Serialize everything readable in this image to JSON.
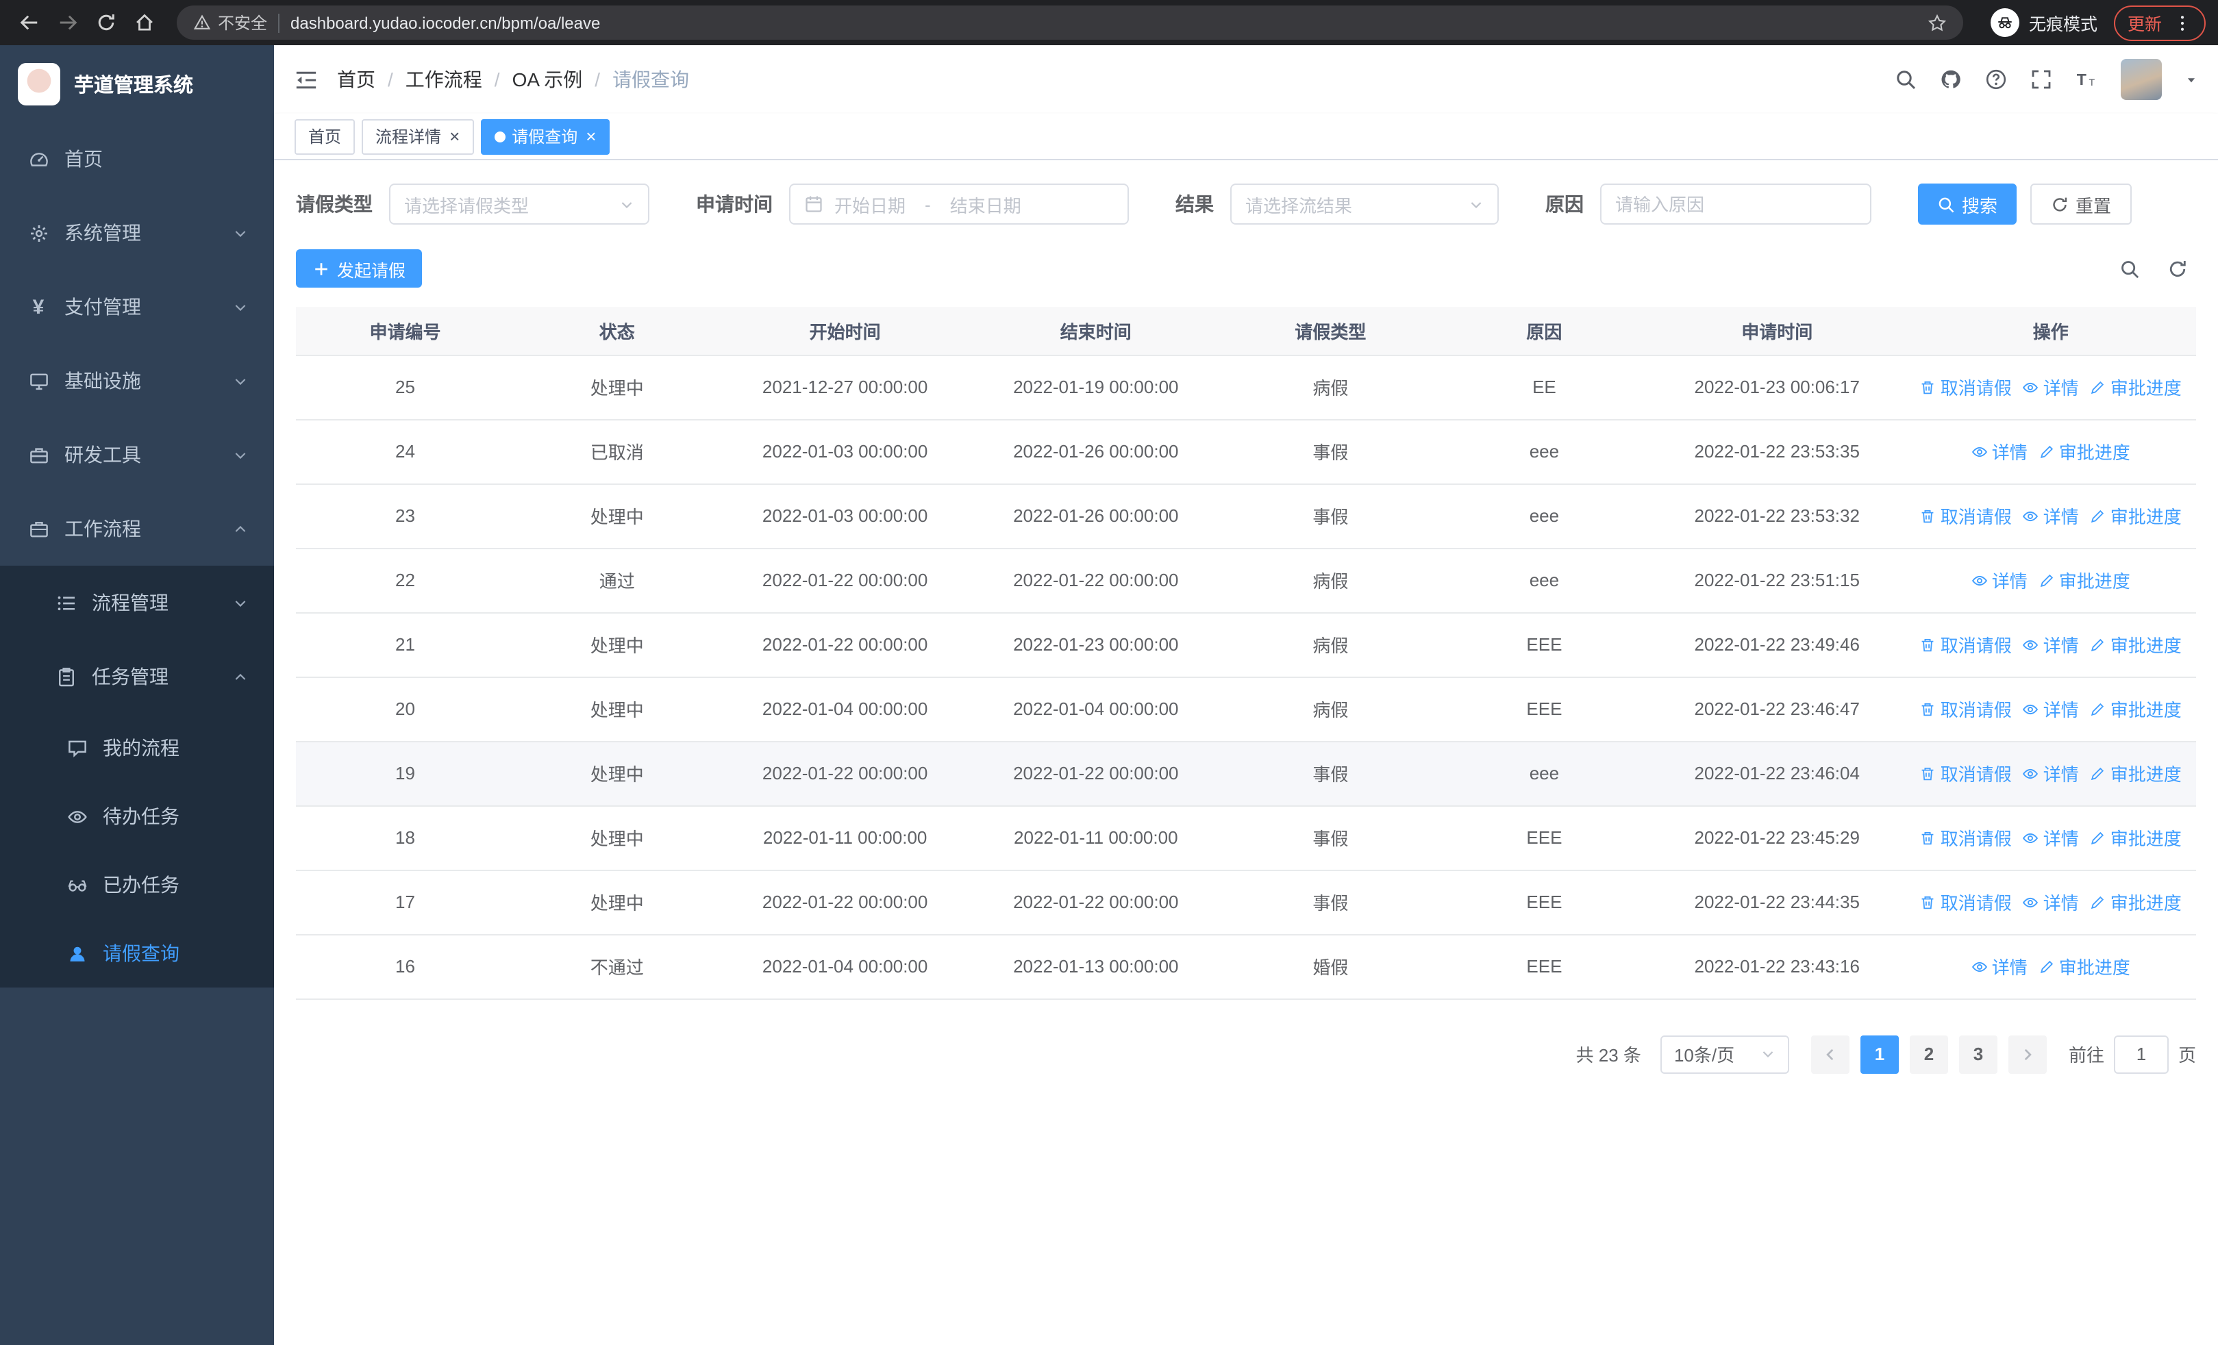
{
  "browser": {
    "security_warning": "不安全",
    "url": "dashboard.yudao.iocoder.cn/bpm/oa/leave",
    "incognito_label": "无痕模式",
    "update_label": "更新"
  },
  "sidebar": {
    "app_title": "芋道管理系统",
    "items": [
      {
        "name": "home",
        "label": "首页",
        "icon": "dashboard",
        "level": 1
      },
      {
        "name": "system-management",
        "label": "系统管理",
        "icon": "gear",
        "level": 1,
        "chevron": "down"
      },
      {
        "name": "payment-management",
        "label": "支付管理",
        "icon": "yen",
        "level": 1,
        "chevron": "down"
      },
      {
        "name": "infrastructure",
        "label": "基础设施",
        "icon": "monitor",
        "level": 1,
        "chevron": "down"
      },
      {
        "name": "dev-tools",
        "label": "研发工具",
        "icon": "toolbox",
        "level": 1,
        "chevron": "down"
      },
      {
        "name": "workflow",
        "label": "工作流程",
        "icon": "briefcase",
        "level": 1,
        "chevron": "up"
      },
      {
        "name": "process-management",
        "label": "流程管理",
        "icon": "list",
        "level": 2,
        "chevron": "down"
      },
      {
        "name": "task-management",
        "label": "任务管理",
        "icon": "clipboard",
        "level": 2,
        "chevron": "up"
      },
      {
        "name": "my-process",
        "label": "我的流程",
        "icon": "chat",
        "level": 3
      },
      {
        "name": "todo-tasks",
        "label": "待办任务",
        "icon": "eye",
        "level": 3
      },
      {
        "name": "done-tasks",
        "label": "已办任务",
        "icon": "glasses",
        "level": 3
      },
      {
        "name": "leave-query",
        "label": "请假查询",
        "icon": "user",
        "level": 3,
        "active": true
      }
    ]
  },
  "header": {
    "breadcrumb": [
      "首页",
      "工作流程",
      "OA 示例",
      "请假查询"
    ]
  },
  "tabs": [
    {
      "name": "tab-home",
      "label": "首页",
      "closable": false,
      "active": false
    },
    {
      "name": "tab-process-detail",
      "label": "流程详情",
      "closable": true,
      "active": false
    },
    {
      "name": "tab-leave-query",
      "label": "请假查询",
      "closable": true,
      "active": true
    }
  ],
  "filters": {
    "leave_type_label": "请假类型",
    "leave_type_placeholder": "请选择请假类型",
    "apply_time_label": "申请时间",
    "start_placeholder": "开始日期",
    "separator": "-",
    "end_placeholder": "结束日期",
    "result_label": "结果",
    "result_placeholder": "请选择流结果",
    "reason_label": "原因",
    "reason_placeholder": "请输入原因",
    "search_label": "搜索",
    "reset_label": "重置"
  },
  "toolbar": {
    "create_label": "发起请假"
  },
  "table": {
    "columns": [
      "申请编号",
      "状态",
      "开始时间",
      "结束时间",
      "请假类型",
      "原因",
      "申请时间",
      "操作"
    ],
    "action_labels": {
      "cancel": "取消请假",
      "detail": "详情",
      "progress": "审批进度"
    },
    "rows": [
      {
        "id": "25",
        "status": "处理中",
        "start_time": "2021-12-27 00:00:00",
        "end_time": "2022-01-19 00:00:00",
        "leave_type": "病假",
        "reason": "EE",
        "apply_time": "2022-01-23 00:06:17",
        "can_cancel": true
      },
      {
        "id": "24",
        "status": "已取消",
        "start_time": "2022-01-03 00:00:00",
        "end_time": "2022-01-26 00:00:00",
        "leave_type": "事假",
        "reason": "eee",
        "apply_time": "2022-01-22 23:53:35",
        "can_cancel": false
      },
      {
        "id": "23",
        "status": "处理中",
        "start_time": "2022-01-03 00:00:00",
        "end_time": "2022-01-26 00:00:00",
        "leave_type": "事假",
        "reason": "eee",
        "apply_time": "2022-01-22 23:53:32",
        "can_cancel": true
      },
      {
        "id": "22",
        "status": "通过",
        "start_time": "2022-01-22 00:00:00",
        "end_time": "2022-01-22 00:00:00",
        "leave_type": "病假",
        "reason": "eee",
        "apply_time": "2022-01-22 23:51:15",
        "can_cancel": false
      },
      {
        "id": "21",
        "status": "处理中",
        "start_time": "2022-01-22 00:00:00",
        "end_time": "2022-01-23 00:00:00",
        "leave_type": "病假",
        "reason": "EEE",
        "apply_time": "2022-01-22 23:49:46",
        "can_cancel": true
      },
      {
        "id": "20",
        "status": "处理中",
        "start_time": "2022-01-04 00:00:00",
        "end_time": "2022-01-04 00:00:00",
        "leave_type": "病假",
        "reason": "EEE",
        "apply_time": "2022-01-22 23:46:47",
        "can_cancel": true
      },
      {
        "id": "19",
        "status": "处理中",
        "start_time": "2022-01-22 00:00:00",
        "end_time": "2022-01-22 00:00:00",
        "leave_type": "事假",
        "reason": "eee",
        "apply_time": "2022-01-22 23:46:04",
        "can_cancel": true,
        "highlighted": true
      },
      {
        "id": "18",
        "status": "处理中",
        "start_time": "2022-01-11 00:00:00",
        "end_time": "2022-01-11 00:00:00",
        "leave_type": "事假",
        "reason": "EEE",
        "apply_time": "2022-01-22 23:45:29",
        "can_cancel": true
      },
      {
        "id": "17",
        "status": "处理中",
        "start_time": "2022-01-22 00:00:00",
        "end_time": "2022-01-22 00:00:00",
        "leave_type": "事假",
        "reason": "EEE",
        "apply_time": "2022-01-22 23:44:35",
        "can_cancel": true
      },
      {
        "id": "16",
        "status": "不通过",
        "start_time": "2022-01-04 00:00:00",
        "end_time": "2022-01-13 00:00:00",
        "leave_type": "婚假",
        "reason": "EEE",
        "apply_time": "2022-01-22 23:43:16",
        "can_cancel": false
      }
    ]
  },
  "pagination": {
    "total_label": "共 23 条",
    "page_size_label": "10条/页",
    "pages": [
      "1",
      "2",
      "3"
    ],
    "active_page": "1",
    "goto_prefix": "前往",
    "goto_value": "1",
    "goto_suffix": "页"
  },
  "colors": {
    "primary": "#409eff",
    "sidebar_bg": "#304156",
    "submenu_bg": "#1f2d3d",
    "browser_bg": "#202124",
    "update_red": "#ee6055"
  }
}
